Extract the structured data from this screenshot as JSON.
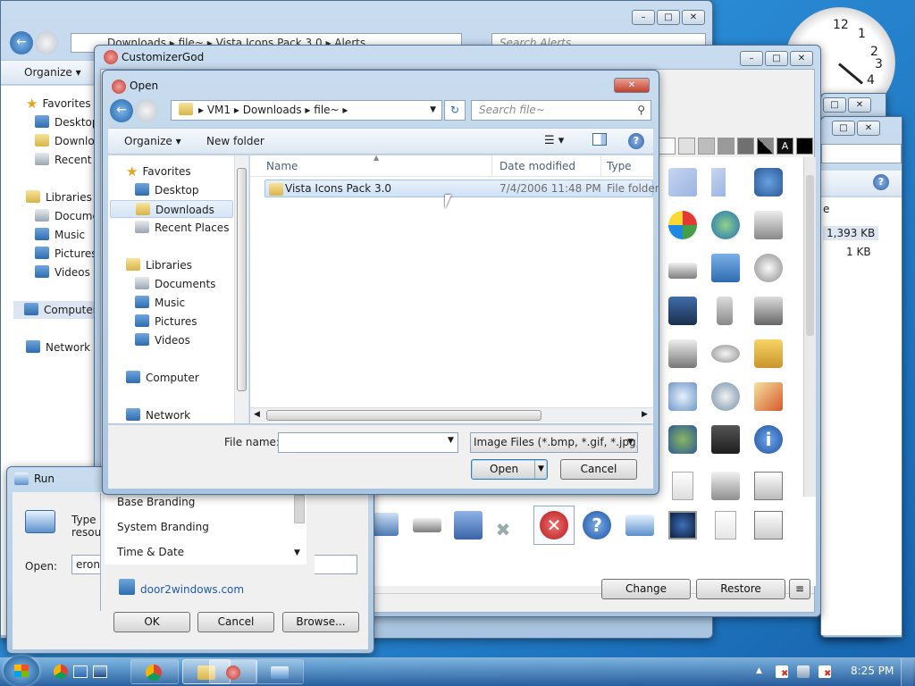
{
  "explorer_back": {
    "address": [
      "Downloads",
      "file~",
      "Vista Icons Pack 3.0",
      "Alerts"
    ],
    "search_placeholder": "Search Alerts",
    "organize": "Organize",
    "nav": [
      "Favorites",
      "Desktop",
      "Downloads",
      "Recent P",
      "Libraries",
      "Docume",
      "Music",
      "Pictures",
      "Videos",
      "Computer",
      "Network"
    ]
  },
  "right_explorer": {
    "sizes": [
      "1,393 KB",
      "1 KB"
    ],
    "partial": "e"
  },
  "customizer": {
    "title": "CustomizerGod",
    "list": [
      "Base Branding",
      "System Branding",
      "Time & Date"
    ],
    "link": "door2windows.com",
    "change": "Change",
    "restore": "Restore",
    "menu": "≡"
  },
  "open_dialog": {
    "title": "Open",
    "address": [
      "VM1",
      "Downloads",
      "file~"
    ],
    "search_placeholder": "Search file~",
    "organize": "Organize",
    "new_folder": "New folder",
    "nav": {
      "favorites": "Favorites",
      "desktop": "Desktop",
      "downloads": "Downloads",
      "recent": "Recent Places",
      "libraries": "Libraries",
      "documents": "Documents",
      "music": "Music",
      "pictures": "Pictures",
      "videos": "Videos",
      "computer": "Computer",
      "network": "Network"
    },
    "columns": {
      "name": "Name",
      "date": "Date modified",
      "type": "Type"
    },
    "rows": [
      {
        "name": "Vista Icons Pack 3.0",
        "date": "7/4/2006 11:48 PM",
        "type": "File folder"
      }
    ],
    "filename_label": "File name:",
    "filename_value": "",
    "filetype": "Image Files (*.bmp, *.gif, *.jpg,",
    "open": "Open",
    "cancel": "Cancel"
  },
  "run_dialog": {
    "title": "Run",
    "text": "Type\nresou",
    "open_label": "Open:",
    "open_value": "eron",
    "ok": "OK",
    "cancel": "Cancel",
    "browse": "Browse..."
  },
  "taskbar": {
    "time": "8:25 PM"
  },
  "clock": {
    "hour_marks": [
      "12",
      "1",
      "2",
      "3",
      "4"
    ]
  }
}
